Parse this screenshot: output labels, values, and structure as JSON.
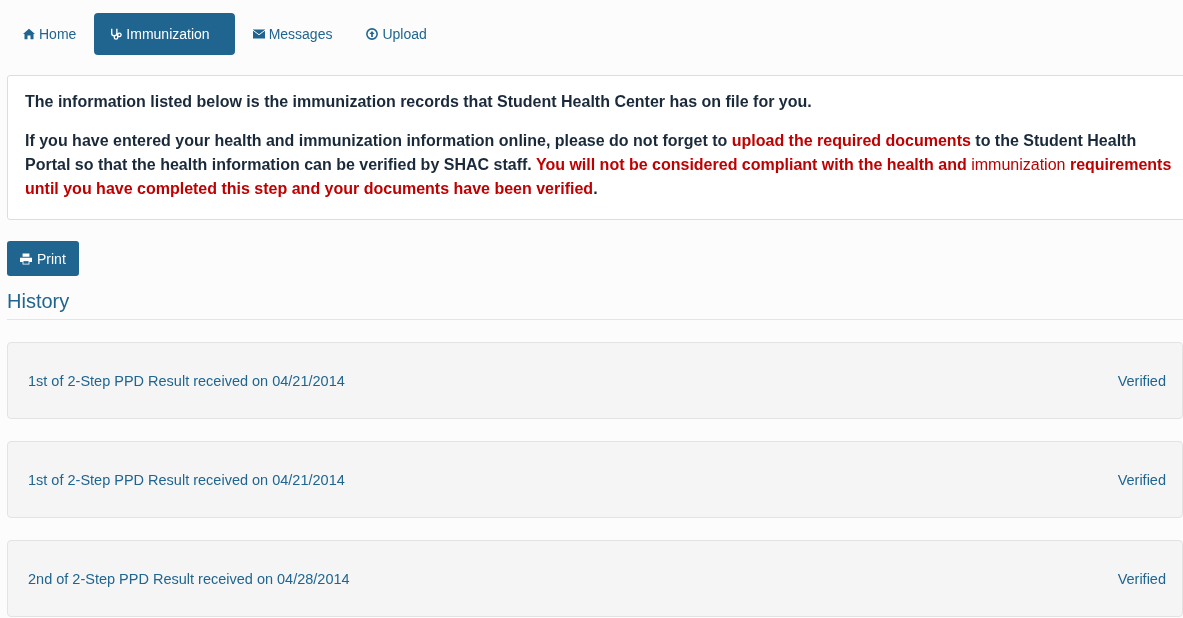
{
  "tabs": [
    {
      "label": "Home",
      "selected": false
    },
    {
      "label": "Immunization",
      "selected": true
    },
    {
      "label": "Messages",
      "selected": false
    },
    {
      "label": "Upload",
      "selected": false
    }
  ],
  "notice": {
    "intro": "The information listed below is the immunization records that Student Health Center has on file for you.",
    "paragraph": [
      {
        "text": "If you have entered your health and immunization information online, please do not forget to ",
        "kind": "bold"
      },
      {
        "text": "upload the required documents",
        "kind": "alert"
      },
      {
        "text": " to the Student Health Portal so that the health information can be verified by SHAC staff. ",
        "kind": "bold"
      },
      {
        "text": "You will not be considered compliant with the health and ",
        "kind": "alert"
      },
      {
        "text": "immunization",
        "kind": "alert-plain"
      },
      {
        "text": " requirements until you have completed this step and your documents have been verified",
        "kind": "alert"
      },
      {
        "text": ".",
        "kind": "bold"
      }
    ]
  },
  "print_button": "Print",
  "history": {
    "title": "History",
    "records": [
      {
        "description": "1st of 2-Step PPD Result received on 04/21/2014",
        "status": "Verified"
      },
      {
        "description": "1st of 2-Step PPD Result received on 04/21/2014",
        "status": "Verified"
      },
      {
        "description": "2nd of 2-Step PPD Result received on 04/28/2014",
        "status": "Verified"
      }
    ]
  }
}
